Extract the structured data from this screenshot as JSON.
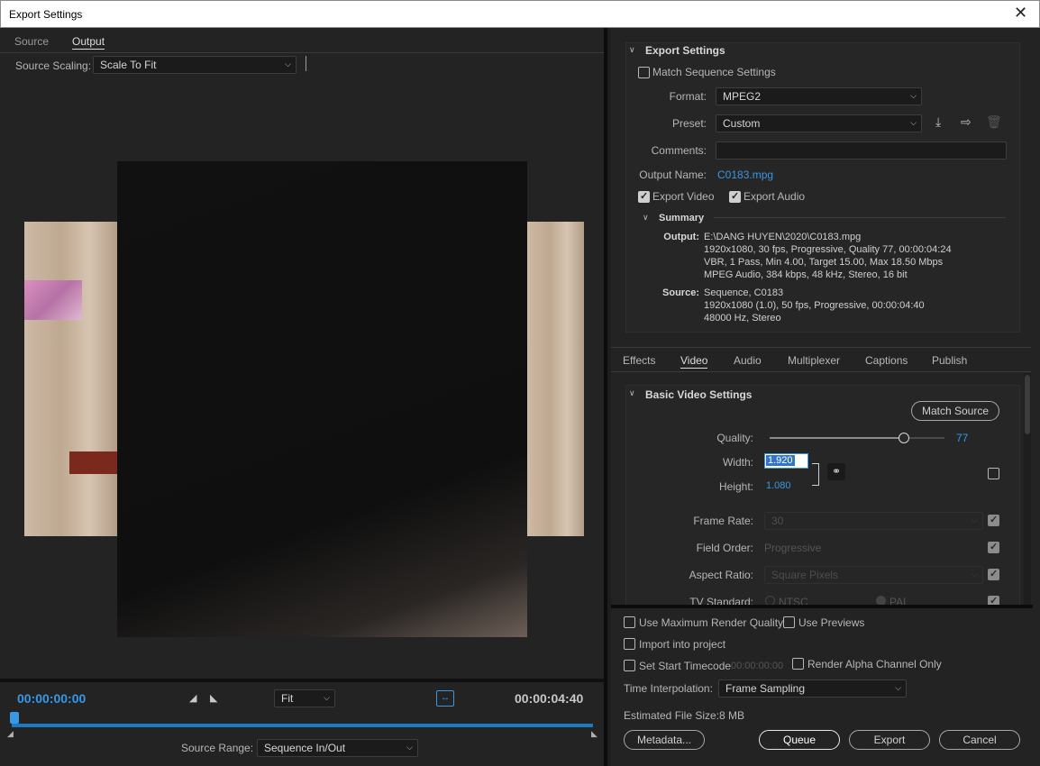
{
  "window": {
    "title": "Export Settings"
  },
  "left": {
    "tabs": {
      "source": "Source",
      "output": "Output"
    },
    "source_scaling_label": "Source Scaling:",
    "source_scaling_value": "Scale To Fit",
    "timecode_start": "00:00:00:00",
    "timecode_end": "00:00:04:40",
    "fit_value": "Fit",
    "source_range_label": "Source Range:",
    "source_range_value": "Sequence In/Out"
  },
  "export_settings": {
    "header": "Export Settings",
    "match_sequence": "Match Sequence Settings",
    "format_label": "Format:",
    "format_value": "MPEG2",
    "preset_label": "Preset:",
    "preset_value": "Custom",
    "comments_label": "Comments:",
    "comments_value": "",
    "output_name_label": "Output Name:",
    "output_name_value": "C0183.mpg",
    "export_video": "Export Video",
    "export_audio": "Export Audio"
  },
  "summary": {
    "header": "Summary",
    "output_label": "Output:",
    "output_lines": [
      "E:\\DANG HUYEN\\2020\\C0183.mpg",
      "1920x1080, 30 fps, Progressive, Quality 77, 00:00:04:24",
      "VBR, 1 Pass, Min 4.00, Target 15.00, Max 18.50 Mbps",
      "MPEG Audio, 384 kbps, 48 kHz, Stereo, 16 bit"
    ],
    "source_label": "Source:",
    "source_lines": [
      "Sequence, C0183",
      "1920x1080 (1.0), 50 fps, Progressive, 00:00:04:40",
      "48000 Hz, Stereo"
    ]
  },
  "settings_tabs": [
    "Effects",
    "Video",
    "Audio",
    "Multiplexer",
    "Captions",
    "Publish"
  ],
  "video": {
    "header": "Basic Video Settings",
    "match_source": "Match Source",
    "quality_label": "Quality:",
    "quality_value": "77",
    "quality_fraction": 0.77,
    "width_label": "Width:",
    "width_value": "1.920",
    "height_label": "Height:",
    "height_value": "1.080",
    "frame_rate_label": "Frame Rate:",
    "frame_rate_value": "30",
    "field_order_label": "Field Order:",
    "field_order_value": "Progressive",
    "aspect_ratio_label": "Aspect Ratio:",
    "aspect_ratio_value": "Square Pixels",
    "tv_standard_label": "TV Standard:",
    "tv_ntsc": "NTSC",
    "tv_pal": "PAL"
  },
  "bottom": {
    "max_render_quality": "Use Maximum Render Quality",
    "use_previews": "Use Previews",
    "import_into_project": "Import into project",
    "set_start_timecode": "Set Start Timecode",
    "start_timecode_value": "00:00:00:00",
    "render_alpha": "Render Alpha Channel Only",
    "time_interp_label": "Time Interpolation:",
    "time_interp_value": "Frame Sampling",
    "file_size_label": "Estimated File Size:",
    "file_size_value": "8 MB",
    "metadata": "Metadata...",
    "queue": "Queue",
    "export": "Export",
    "cancel": "Cancel"
  },
  "colors": {
    "accent": "#3a97e2",
    "timeline": "#1b7ac4"
  }
}
